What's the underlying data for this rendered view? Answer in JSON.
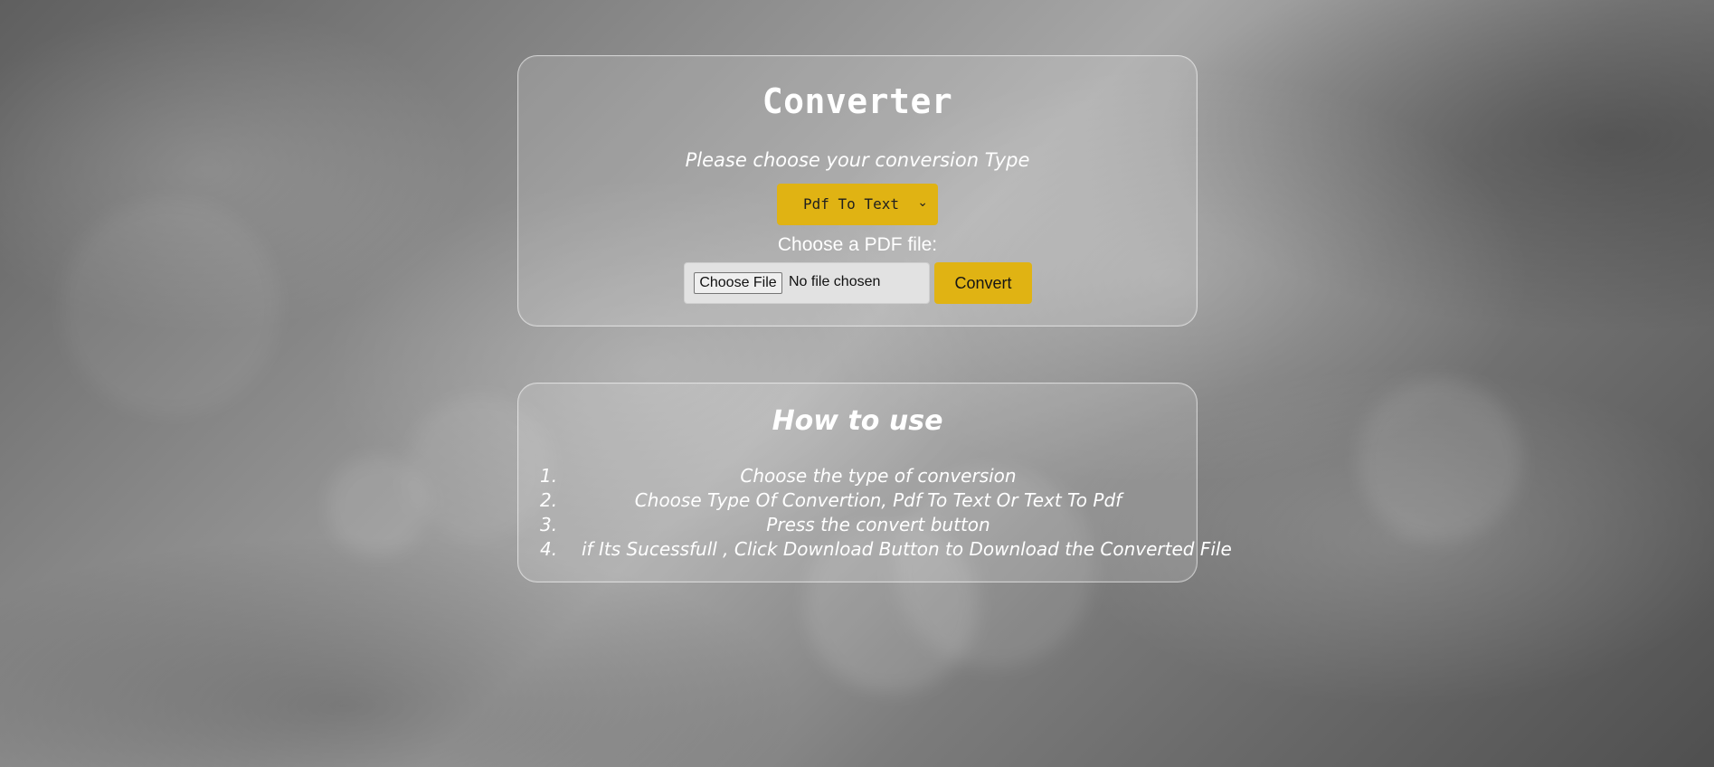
{
  "converter": {
    "title": "Converter",
    "subtitle": "Please choose your conversion Type",
    "selected_type": "Pdf To Text",
    "file_label": "Choose a PDF file:",
    "choose_file": "Choose File",
    "file_status": "No file chosen",
    "convert": "Convert"
  },
  "how_to_use": {
    "title": "How to use",
    "steps": [
      {
        "number": "1.",
        "text": "Choose the type of conversion"
      },
      {
        "number": "2.",
        "text": "Choose Type Of Convertion, Pdf To Text Or Text To Pdf"
      },
      {
        "number": "3.",
        "text": "Press the convert button"
      },
      {
        "number": "4.",
        "text": "if Its Sucessfull , Click Download Button to Download the Converted File"
      }
    ]
  },
  "colors": {
    "accent": "#e0b313",
    "text": "#ffffff",
    "card_border": "#ffffff",
    "file_box": "#e2e2e2"
  },
  "icons": {
    "select_chevron": "chevron-down-icon"
  }
}
